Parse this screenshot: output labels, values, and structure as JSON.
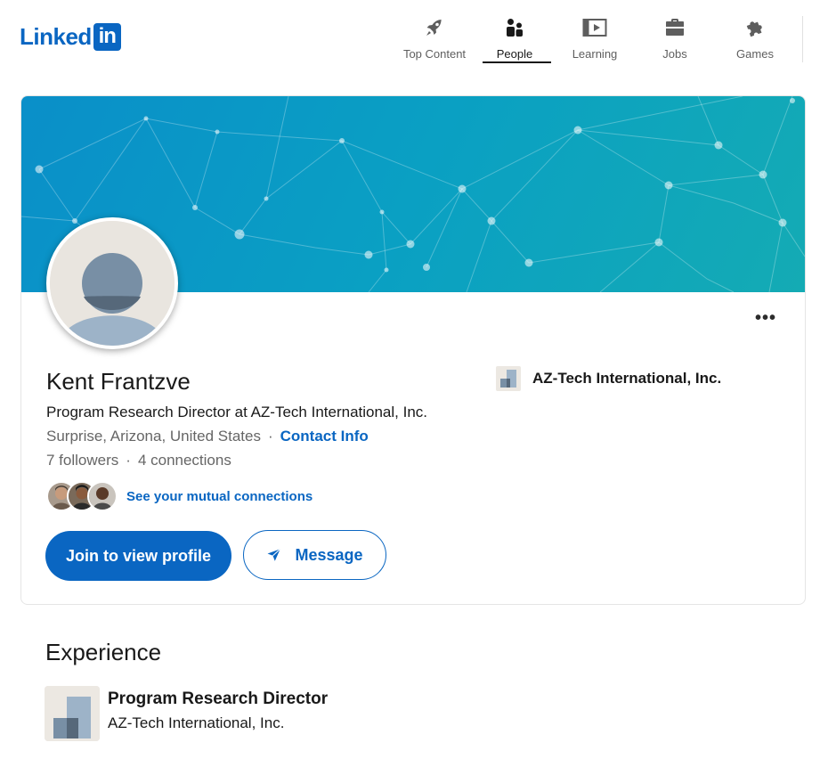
{
  "header": {
    "logo_text": "Linked",
    "logo_box_text": "in",
    "nav": [
      {
        "label": "Top Content",
        "icon": "rocket-icon"
      },
      {
        "label": "People",
        "icon": "people-icon"
      },
      {
        "label": "Learning",
        "icon": "video-icon"
      },
      {
        "label": "Jobs",
        "icon": "briefcase-icon"
      },
      {
        "label": "Games",
        "icon": "puzzle-icon"
      }
    ],
    "active_nav": "People"
  },
  "profile": {
    "name": "Kent Frantzve",
    "headline": "Program Research Director at AZ-Tech International, Inc.",
    "location": "Surprise, Arizona, United States",
    "separator": "·",
    "contact_link": "Contact Info",
    "followers": "7 followers",
    "connections": "4 connections",
    "mutual_link": "See your mutual connections",
    "join_button": "Join to view profile",
    "message_button": "Message",
    "more_button": "•••",
    "current_company": "AZ-Tech International, Inc."
  },
  "experience": {
    "title": "Experience",
    "items": [
      {
        "role": "Program Research Director",
        "company": "AZ-Tech International, Inc."
      }
    ]
  },
  "colors": {
    "brand": "#0a66c2",
    "banner_start": "#0a8fc9",
    "banner_end": "#14abb4",
    "text_primary": "#191919",
    "text_secondary": "#666666"
  }
}
